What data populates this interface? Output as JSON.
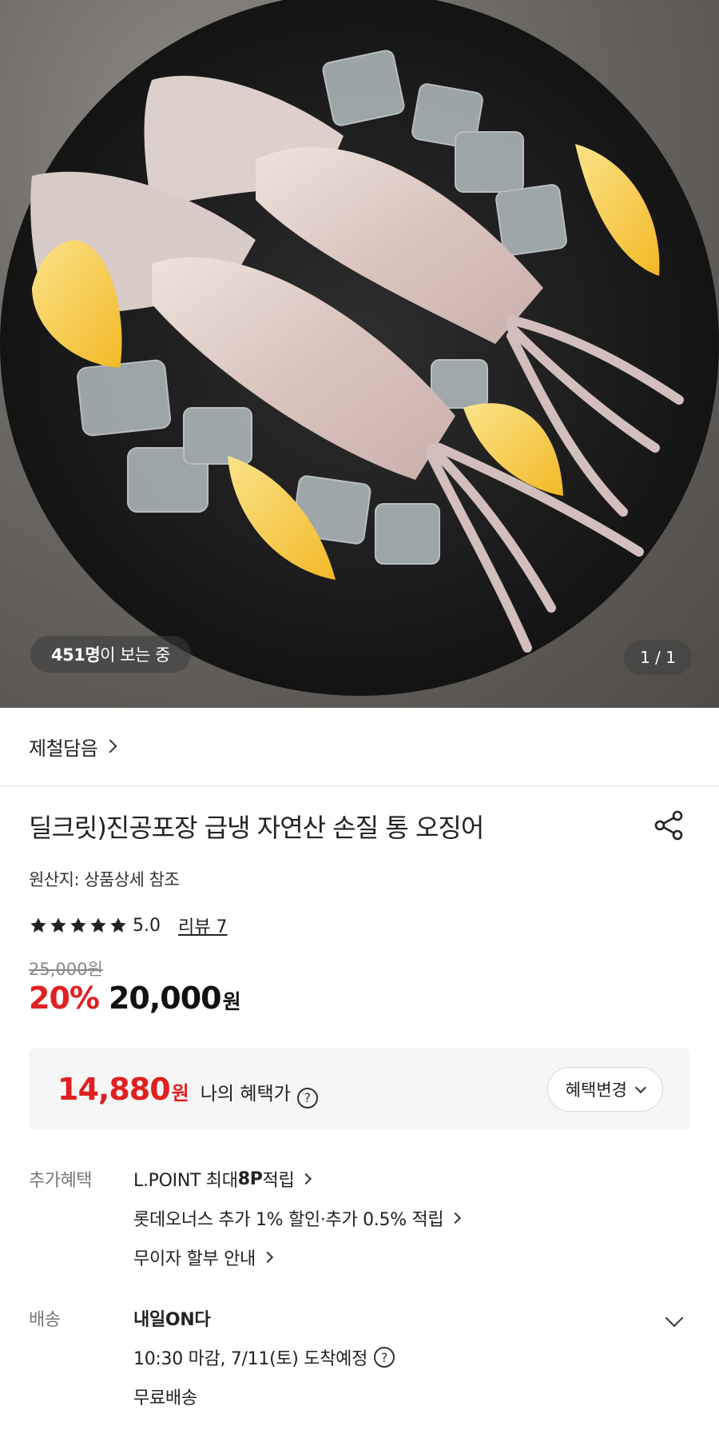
{
  "hero": {
    "viewer_count": "451명",
    "viewer_suffix": "이 보는 중",
    "page_indicator": "1 / 1"
  },
  "brand": {
    "name": "제철담음"
  },
  "product": {
    "title": "딜크릿)진공포장 급냉 자연산 손질 통 오징어",
    "origin": "원산지: 상품상세 참조",
    "rating": "5.0",
    "stars": 5,
    "review_label": "리뷰 7",
    "original_price": "25,000원",
    "discount": "20%",
    "sale_price": "20,000",
    "sale_currency": "원"
  },
  "benefit": {
    "amount": "14,880",
    "currency": "원",
    "label": "나의 혜택가",
    "change_button": "혜택변경"
  },
  "extra_benefits": {
    "label": "추가혜택",
    "items": [
      {
        "prefix": "L.POINT 최대 ",
        "bold": "8P",
        "suffix": " 적립"
      },
      {
        "prefix": "롯데오너스 추가 1% 할인·추가 0.5% 적립",
        "bold": "",
        "suffix": ""
      },
      {
        "prefix": "무이자 할부 안내",
        "bold": "",
        "suffix": ""
      }
    ]
  },
  "shipping": {
    "label": "배송",
    "title": "내일ON다",
    "eta": "10:30 마감, 7/11(토) 도착예정",
    "fee": "무료배송"
  },
  "colors": {
    "accent_red": "#e02020",
    "benefit_bg": "#f6f6f6"
  },
  "icons": {
    "share": "share-icon",
    "help": "question-circle-icon",
    "star": "star-icon"
  }
}
